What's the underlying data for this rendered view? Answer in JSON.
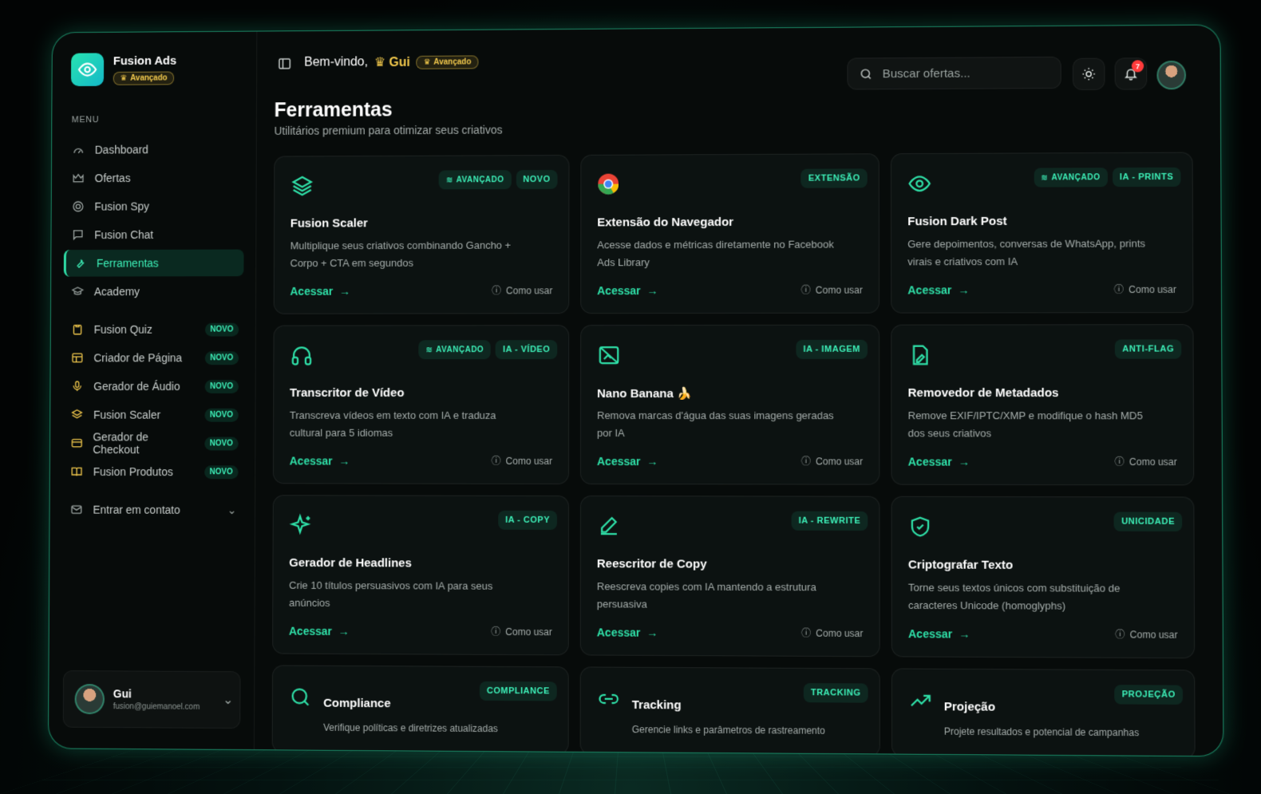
{
  "app": {
    "name": "Fusion Ads",
    "plan": "Avançado"
  },
  "colors": {
    "accent": "#2fe0a8",
    "gold": "#f2c94c",
    "background": "#070b0a",
    "alert": "#ff3b3b"
  },
  "sidebar": {
    "menu_label": "MENU",
    "items": [
      {
        "label": "Dashboard",
        "icon": "gauge-icon"
      },
      {
        "label": "Ofertas",
        "icon": "crown-icon"
      },
      {
        "label": "Fusion Spy",
        "icon": "spy-icon"
      },
      {
        "label": "Fusion Chat",
        "icon": "chat-icon"
      },
      {
        "label": "Ferramentas",
        "icon": "wrench-icon",
        "active": true
      },
      {
        "label": "Academy",
        "icon": "graduation-cap-icon"
      }
    ],
    "extras": [
      {
        "label": "Fusion Quiz",
        "badge": "NOVO",
        "icon": "clipboard-icon"
      },
      {
        "label": "Criador de Página",
        "badge": "NOVO",
        "icon": "layout-icon"
      },
      {
        "label": "Gerador de Áudio",
        "badge": "NOVO",
        "icon": "microphone-icon"
      },
      {
        "label": "Fusion Scaler",
        "badge": "NOVO",
        "icon": "layers-icon"
      },
      {
        "label": "Gerador de Checkout",
        "badge": "NOVO",
        "icon": "checkout-icon"
      },
      {
        "label": "Fusion Produtos",
        "badge": "NOVO",
        "icon": "book-icon"
      }
    ],
    "contact": "Entrar em contato",
    "user": {
      "name": "Gui",
      "email": "fusion@guiemanoel.com"
    }
  },
  "header": {
    "welcome": "Bem-vindo,",
    "user_name": "Gui",
    "plan_badge": "Avançado",
    "search_placeholder": "Buscar ofertas...",
    "notification_count": "7"
  },
  "page": {
    "title": "Ferramentas",
    "subtitle": "Utilitários premium para otimizar seus criativos"
  },
  "common": {
    "access": "Acessar",
    "help": "Como usar"
  },
  "cards": [
    {
      "title": "Fusion Scaler",
      "desc": "Multiplique seus criativos combinando Gancho + Corpo + CTA em segundos",
      "tags": [
        "AVANÇADO",
        "NOVO"
      ],
      "icon": "layers-icon"
    },
    {
      "title": "Extensão do Navegador",
      "desc": "Acesse dados e métricas diretamente no Facebook Ads Library",
      "tags": [
        "EXTENSÃO"
      ],
      "icon": "chrome-icon"
    },
    {
      "title": "Fusion Dark Post",
      "desc": "Gere depoimentos, conversas de WhatsApp, prints virais e criativos com IA",
      "tags": [
        "AVANÇADO",
        "IA - PRINTS"
      ],
      "icon": "eye-icon"
    },
    {
      "title": "Transcritor de Vídeo",
      "desc": "Transcreva vídeos em texto com IA e traduza cultural para 5 idiomas",
      "tags": [
        "AVANÇADO",
        "IA - VÍDEO"
      ],
      "icon": "headphones-icon"
    },
    {
      "title": "Nano Banana 🍌",
      "desc": "Remova marcas d'água das suas imagens geradas por IA",
      "tags": [
        "IA - IMAGEM"
      ],
      "icon": "image-off-icon"
    },
    {
      "title": "Removedor de Metadados",
      "desc": "Remove EXIF/IPTC/XMP e modifique o hash MD5 dos seus criativos",
      "tags": [
        "ANTI-FLAG"
      ],
      "icon": "file-edit-icon"
    },
    {
      "title": "Gerador de Headlines",
      "desc": "Crie 10 títulos persuasivos com IA para seus anúncios",
      "tags": [
        "IA - COPY"
      ],
      "icon": "sparkles-icon"
    },
    {
      "title": "Reescritor de Copy",
      "desc": "Reescreva copies com IA mantendo a estrutura persuasiva",
      "tags": [
        "IA - REWRITE"
      ],
      "icon": "pen-icon"
    },
    {
      "title": "Criptografar Texto",
      "desc": "Torne seus textos únicos com substituição de caracteres Unicode (homoglyphs)",
      "tags": [
        "UNICIDADE"
      ],
      "icon": "shield-check-icon"
    },
    {
      "title": "Compliance",
      "desc": "Verifique políticas e diretrizes atualizadas",
      "tags": [
        "COMPLIANCE"
      ],
      "icon": "search-icon"
    },
    {
      "title": "Tracking",
      "desc": "Gerencie links e parâmetros de rastreamento",
      "tags": [
        "TRACKING"
      ],
      "icon": "link-icon"
    },
    {
      "title": "Projeção",
      "desc": "Projete resultados e potencial de campanhas",
      "tags": [
        "PROJEÇÃO"
      ],
      "icon": "trending-up-icon"
    }
  ]
}
